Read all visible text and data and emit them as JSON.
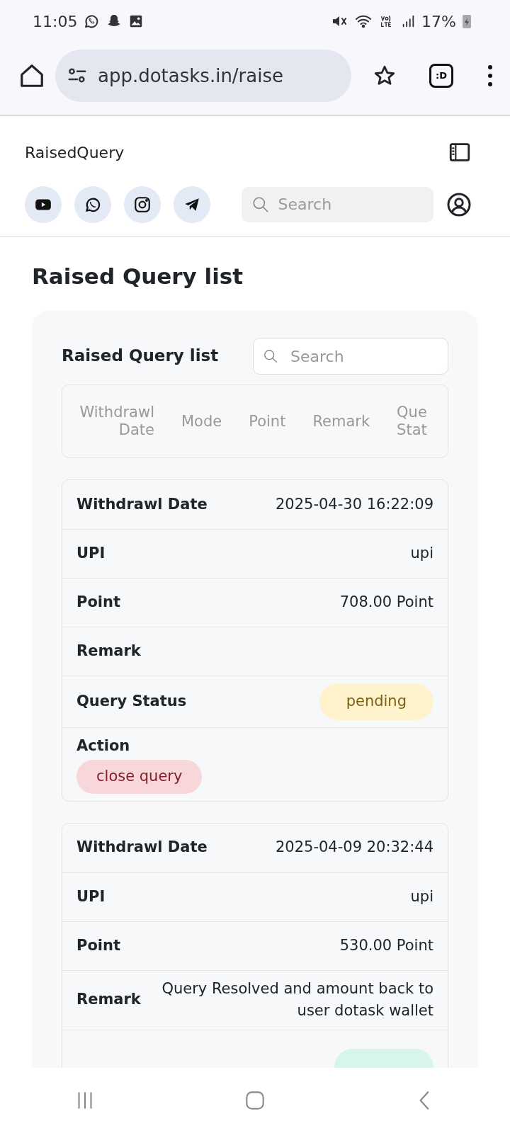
{
  "status_bar": {
    "time": "11:05",
    "battery": "17%"
  },
  "browser": {
    "url": "app.dotasks.in/raise",
    "tab_button": ":D"
  },
  "header": {
    "brand": "RaisedQuery",
    "search": {
      "placeholder": "Search"
    }
  },
  "page_title": "Raised Query list",
  "panel": {
    "title": "Raised Query list",
    "search": {
      "placeholder": "Search"
    },
    "columns": [
      "Withdrawl Date",
      "Mode",
      "Point",
      "Remark",
      "Que Stat"
    ],
    "records": [
      {
        "fields": [
          {
            "kind": "text",
            "label": "Withdrawl Date",
            "value": "2025-04-30 16:22:09"
          },
          {
            "kind": "text",
            "label": "UPI",
            "value": "upi"
          },
          {
            "kind": "text",
            "label": "Point",
            "value": "708.00 Point"
          },
          {
            "kind": "text",
            "label": "Remark"
          },
          {
            "kind": "status",
            "label": "Query Status",
            "value": "pending",
            "color": "#fff3cd"
          },
          {
            "kind": "action",
            "label": "Action",
            "value": "close query"
          }
        ]
      },
      {
        "fields": [
          {
            "kind": "text",
            "label": "Withdrawl Date",
            "value": "2025-04-09 20:32:44"
          },
          {
            "kind": "text",
            "label": "UPI",
            "value": "upi"
          },
          {
            "kind": "text",
            "label": "Point",
            "value": "530.00 Point"
          },
          {
            "kind": "text",
            "label": "Remark",
            "value": "Query Resolved and amount back to user dotask wallet"
          },
          {
            "kind": "status",
            "color": "#d8f5ea"
          }
        ]
      }
    ]
  }
}
